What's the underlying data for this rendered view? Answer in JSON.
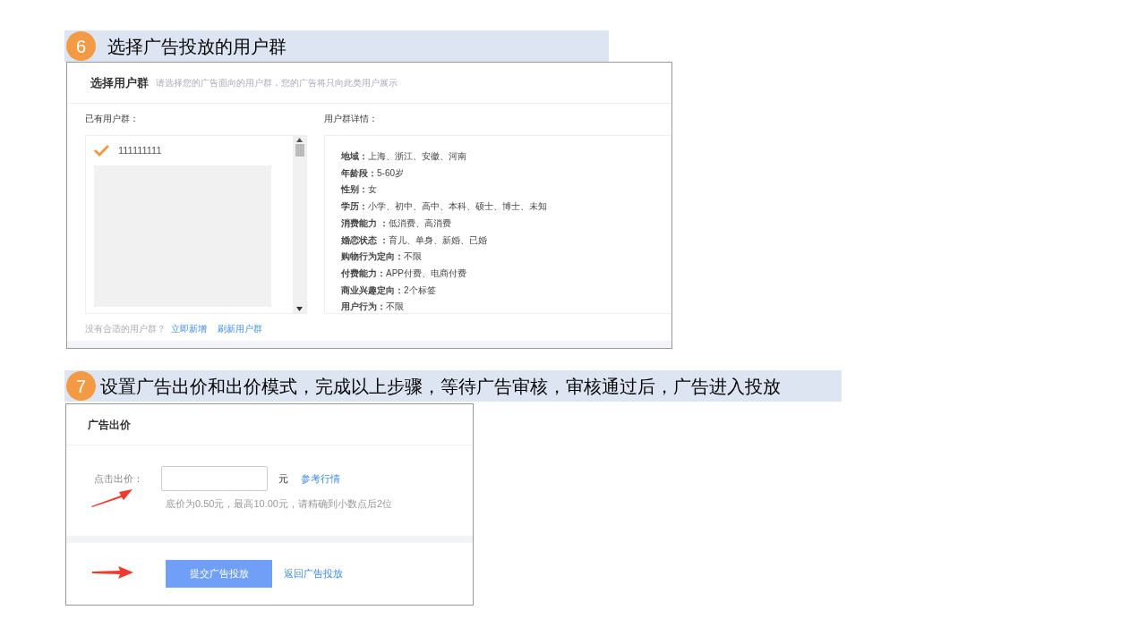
{
  "steps": [
    {
      "number": "6",
      "title": "选择广告投放的用户群"
    },
    {
      "number": "7",
      "title": "设置广告出价和出价模式，完成以上步骤，等待广告审核，审核通过后，广告进入投放"
    }
  ],
  "audience_panel": {
    "title": "选择用户群",
    "hint": "请选择您的广告面向的用户群，您的广告将只向此类用户展示",
    "existing_label": "已有用户群：",
    "groups": [
      {
        "name": "111111111",
        "selected": true
      }
    ],
    "details_label": "用户群详情：",
    "details": [
      {
        "label": "地域：",
        "value": "上海、浙江、安徽、河南"
      },
      {
        "label": "年龄段：",
        "value": "5-60岁"
      },
      {
        "label": "性别：",
        "value": "女"
      },
      {
        "label": "学历：",
        "value": "小学、初中、高中、本科、硕士、博士、未知"
      },
      {
        "label": "消费能力 ：",
        "value": "低消费、高消费"
      },
      {
        "label": "婚恋状态 ：",
        "value": "育儿、单身、新婚、已婚"
      },
      {
        "label": "购物行为定向：",
        "value": "不限"
      },
      {
        "label": "付费能力：",
        "value": "APP付费、电商付费"
      },
      {
        "label": "商业兴趣定向：",
        "value": "2个标签"
      },
      {
        "label": "用户行为：",
        "value": "不限"
      }
    ],
    "footer_text": "没有合适的用户群？",
    "links": [
      "立即新增",
      "刷新用户群"
    ]
  },
  "bid_panel": {
    "title": "广告出价",
    "field_label": "点击出价：",
    "unit": "元",
    "market_link": "参考行情",
    "hint": "底价为0.50元，最高10.00元，请精确到小数点后2位",
    "submit_button": "提交广告投放",
    "back_link": "返回广告投放"
  }
}
